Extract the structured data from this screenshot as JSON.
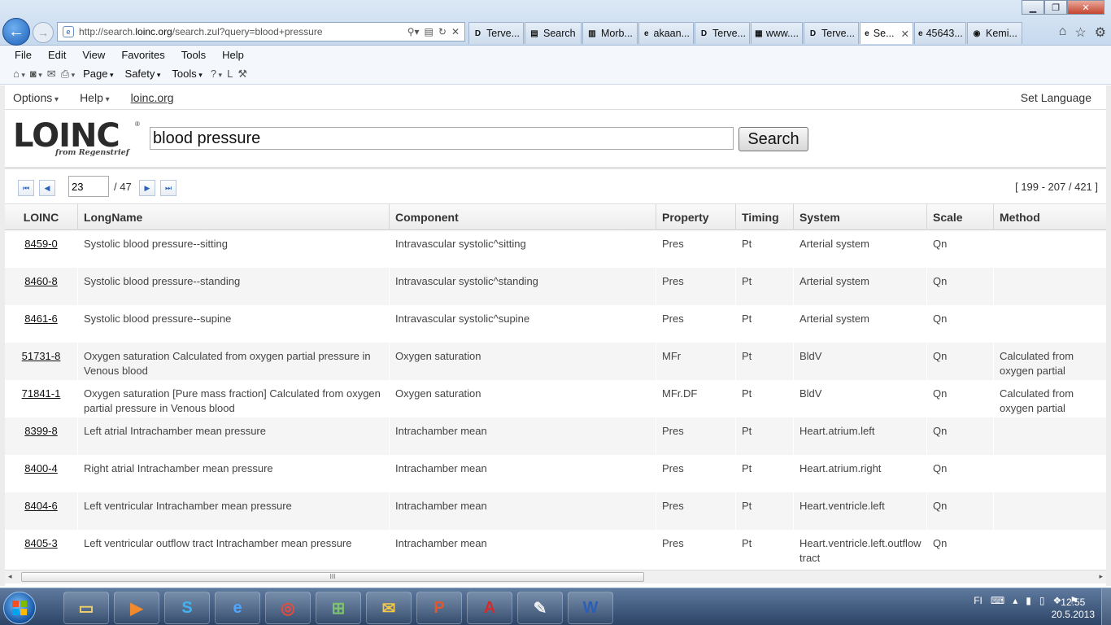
{
  "browser": {
    "address_host_prefix": "http://search.",
    "address_host": "loinc.org",
    "address_path": "/search.zul?query=blood+pressure",
    "tabs": [
      {
        "icon": "D",
        "label": "Terve..."
      },
      {
        "icon": "▤",
        "label": "Search"
      },
      {
        "icon": "▥",
        "label": "Morb..."
      },
      {
        "icon": "e",
        "label": "akaan..."
      },
      {
        "icon": "D",
        "label": "Terve..."
      },
      {
        "icon": "▦",
        "label": "www...."
      },
      {
        "icon": "D",
        "label": "Terve..."
      },
      {
        "icon": "e",
        "label": "Se...",
        "active": true
      },
      {
        "icon": "e",
        "label": "45643..."
      },
      {
        "icon": "◉",
        "label": "Kemi..."
      }
    ],
    "menu": [
      "File",
      "Edit",
      "View",
      "Favorites",
      "Tools",
      "Help"
    ],
    "command_bar": {
      "page": "Page",
      "safety": "Safety",
      "tools": "Tools"
    }
  },
  "site": {
    "options": "Options",
    "help": "Help",
    "home_link": "loinc.org",
    "set_language": "Set Language",
    "logo_text": "LOINC",
    "logo_tag": "from Regenstrief",
    "search_value": "blood pressure",
    "search_button": "Search"
  },
  "pager": {
    "current_page": "23",
    "total": "/ 47",
    "range": "[ 199 - 207 / 421 ]"
  },
  "table": {
    "headers": [
      "LOINC",
      "LongName",
      "Component",
      "Property",
      "Timing",
      "System",
      "Scale",
      "Method"
    ],
    "rows": [
      {
        "loinc": "8459-0",
        "longname": "Systolic blood pressure--sitting",
        "component": "Intravascular systolic^sitting",
        "property": "Pres",
        "timing": "Pt",
        "system": "Arterial system",
        "scale": "Qn",
        "method": ""
      },
      {
        "loinc": "8460-8",
        "longname": "Systolic blood pressure--standing",
        "component": "Intravascular systolic^standing",
        "property": "Pres",
        "timing": "Pt",
        "system": "Arterial system",
        "scale": "Qn",
        "method": ""
      },
      {
        "loinc": "8461-6",
        "longname": "Systolic blood pressure--supine",
        "component": "Intravascular systolic^supine",
        "property": "Pres",
        "timing": "Pt",
        "system": "Arterial system",
        "scale": "Qn",
        "method": ""
      },
      {
        "loinc": "51731-8",
        "longname": "Oxygen saturation Calculated from oxygen partial pressure in Venous blood",
        "component": "Oxygen saturation",
        "property": "MFr",
        "timing": "Pt",
        "system": "BldV",
        "scale": "Qn",
        "method": "Calculated from oxygen partial pressure"
      },
      {
        "loinc": "71841-1",
        "longname": "Oxygen saturation [Pure mass fraction] Calculated from oxygen partial pressure in Venous blood",
        "component": "Oxygen saturation",
        "property": "MFr.DF",
        "timing": "Pt",
        "system": "BldV",
        "scale": "Qn",
        "method": "Calculated from oxygen partial pressure"
      },
      {
        "loinc": "8399-8",
        "longname": "Left atrial Intrachamber mean pressure",
        "component": "Intrachamber mean",
        "property": "Pres",
        "timing": "Pt",
        "system": "Heart.atrium.left",
        "scale": "Qn",
        "method": ""
      },
      {
        "loinc": "8400-4",
        "longname": "Right atrial Intrachamber mean pressure",
        "component": "Intrachamber mean",
        "property": "Pres",
        "timing": "Pt",
        "system": "Heart.atrium.right",
        "scale": "Qn",
        "method": ""
      },
      {
        "loinc": "8404-6",
        "longname": "Left ventricular Intrachamber mean pressure",
        "component": "Intrachamber mean",
        "property": "Pres",
        "timing": "Pt",
        "system": "Heart.ventricle.left",
        "scale": "Qn",
        "method": ""
      },
      {
        "loinc": "8405-3",
        "longname": "Left ventricular outflow tract Intrachamber mean pressure",
        "component": "Intrachamber mean",
        "property": "Pres",
        "timing": "Pt",
        "system": "Heart.ventricle.left.outflow tract",
        "scale": "Qn",
        "method": ""
      }
    ]
  },
  "scrollbar_grip": "III",
  "taskbar": {
    "apps": [
      "explorer-icon",
      "media-player-icon",
      "skype-icon",
      "internet-explorer-icon",
      "chrome-icon",
      "network-app-icon",
      "outlook-icon",
      "powerpoint-icon",
      "acrobat-icon",
      "paint-icon",
      "word-icon"
    ],
    "language": "FI",
    "time": "12:55",
    "date": "20.5.2013"
  }
}
